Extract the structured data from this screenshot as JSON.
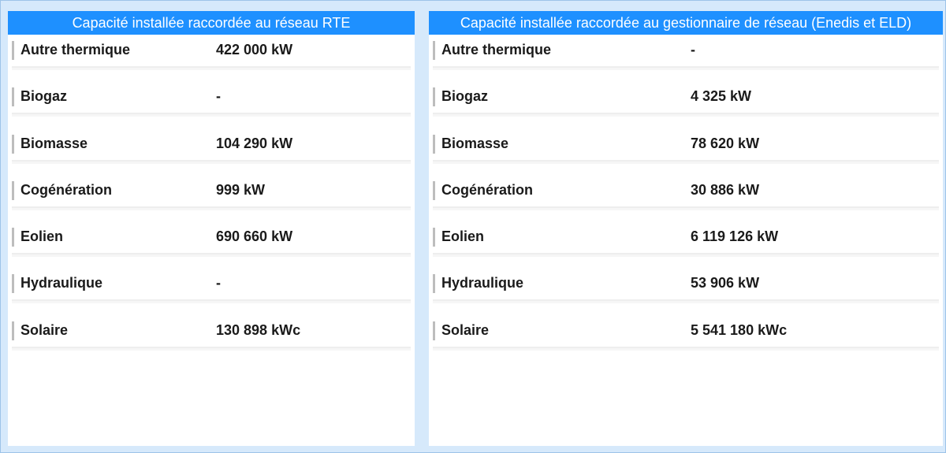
{
  "panels": [
    {
      "title": "Capacité installée raccordée au réseau RTE",
      "rows": [
        {
          "label": "Autre thermique",
          "value": "422 000 kW"
        },
        {
          "label": "Biogaz",
          "value": "-"
        },
        {
          "label": "Biomasse",
          "value": "104 290 kW"
        },
        {
          "label": "Cogénération",
          "value": "999 kW"
        },
        {
          "label": "Eolien",
          "value": "690 660 kW"
        },
        {
          "label": "Hydraulique",
          "value": "-"
        },
        {
          "label": "Solaire",
          "value": "130 898 kWc"
        }
      ]
    },
    {
      "title": "Capacité installée raccordée au gestionnaire de réseau (Enedis et ELD)",
      "rows": [
        {
          "label": "Autre thermique",
          "value": "-"
        },
        {
          "label": "Biogaz",
          "value": "4 325 kW"
        },
        {
          "label": "Biomasse",
          "value": "78 620 kW"
        },
        {
          "label": "Cogénération",
          "value": "30 886 kW"
        },
        {
          "label": "Eolien",
          "value": "6 119 126 kW"
        },
        {
          "label": "Hydraulique",
          "value": "53 906 kW"
        },
        {
          "label": "Solaire",
          "value": "5 541 180 kWc"
        }
      ]
    }
  ],
  "colors": {
    "background": "#d6e9fb",
    "header": "#1e90ff",
    "header_text": "#ffffff",
    "text": "#1a1a1a",
    "row_bar": "#bdbdbd"
  }
}
